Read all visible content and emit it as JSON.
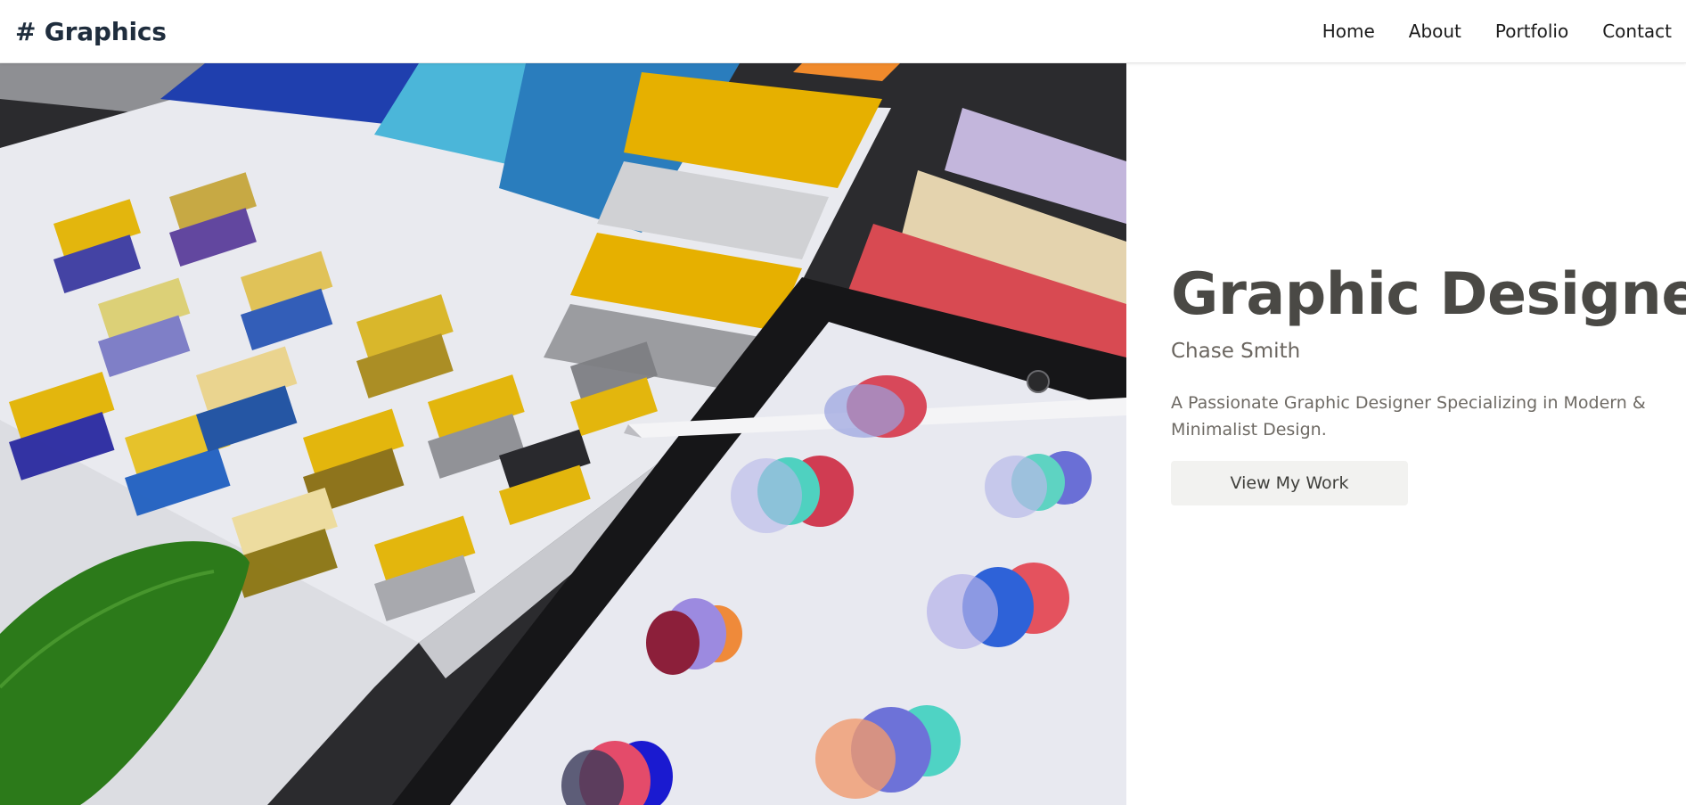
{
  "nav": {
    "brand": "# Graphics",
    "links": [
      "Home",
      "About",
      "Portfolio",
      "Contact"
    ]
  },
  "hero": {
    "title": "Graphic Designer",
    "name": "Chase Smith",
    "description": "A Passionate Graphic Designer Specializing in Modern & Minimalist Design.",
    "button_label": "View My Work",
    "image_alt_icon": "photo-of-color-swatches-and-tablet"
  },
  "colors": {
    "title": "#4a4945",
    "brand": "#1f2d3d",
    "button_bg": "#f2f2f0"
  }
}
